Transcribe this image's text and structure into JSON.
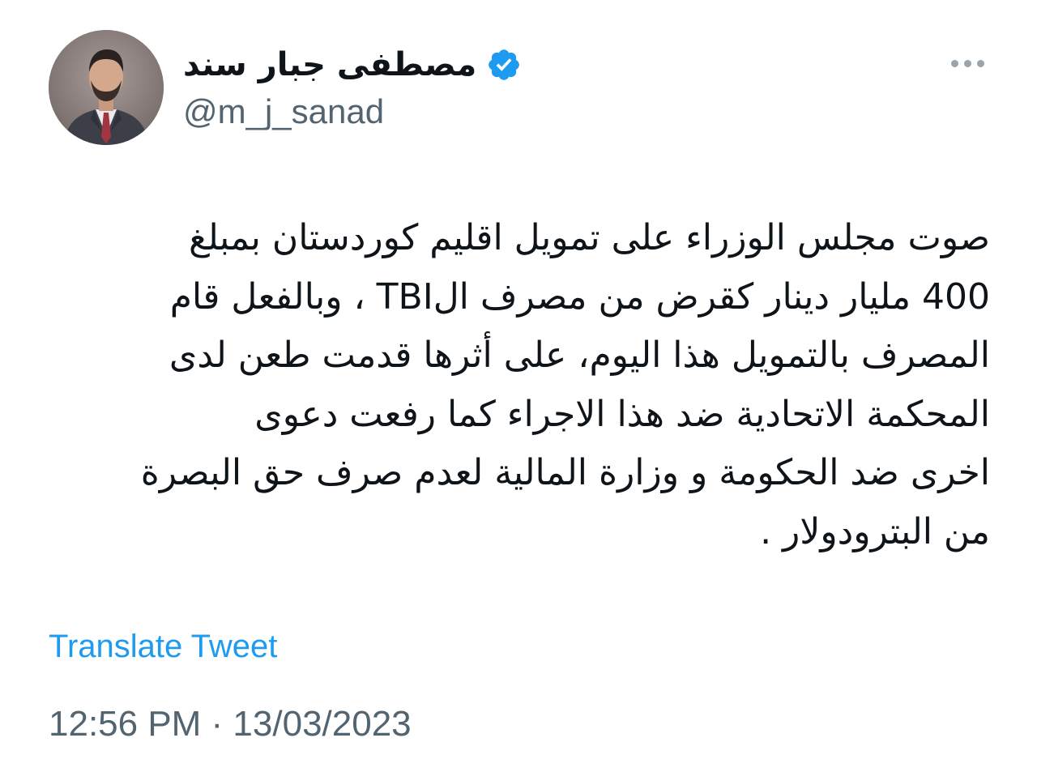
{
  "author": {
    "display_name": "مصطفى جبار سند",
    "username": "@m_j_sanad",
    "verified": true,
    "avatar_icon": "person-portrait-avatar"
  },
  "tweet": {
    "lines": [
      "صوت مجلس الوزراء على تمويل اقليم كوردستان بمبلغ",
      "400 مليار دينار كقرض من مصرف الTBI ، وبالفعل قام",
      "المصرف بالتمويل هذا اليوم، على أثرها قدمت طعن لدى",
      "المحكمة الاتحادية ضد هذا الاجراء كما رفعت دعوى",
      "اخرى ضد الحكومة و وزارة المالية لعدم صرف حق البصرة",
      "من البترودولار ."
    ],
    "translate_label": "Translate Tweet",
    "timestamp": "12:56 PM · 13/03/2023"
  },
  "icons": {
    "verified": "verified-badge-icon",
    "more": "more-options-icon"
  },
  "colors": {
    "link": "#1d9bf0",
    "secondary_text": "#536471",
    "primary_text": "#0f1419",
    "verified_badge": "#1d9bf0"
  }
}
